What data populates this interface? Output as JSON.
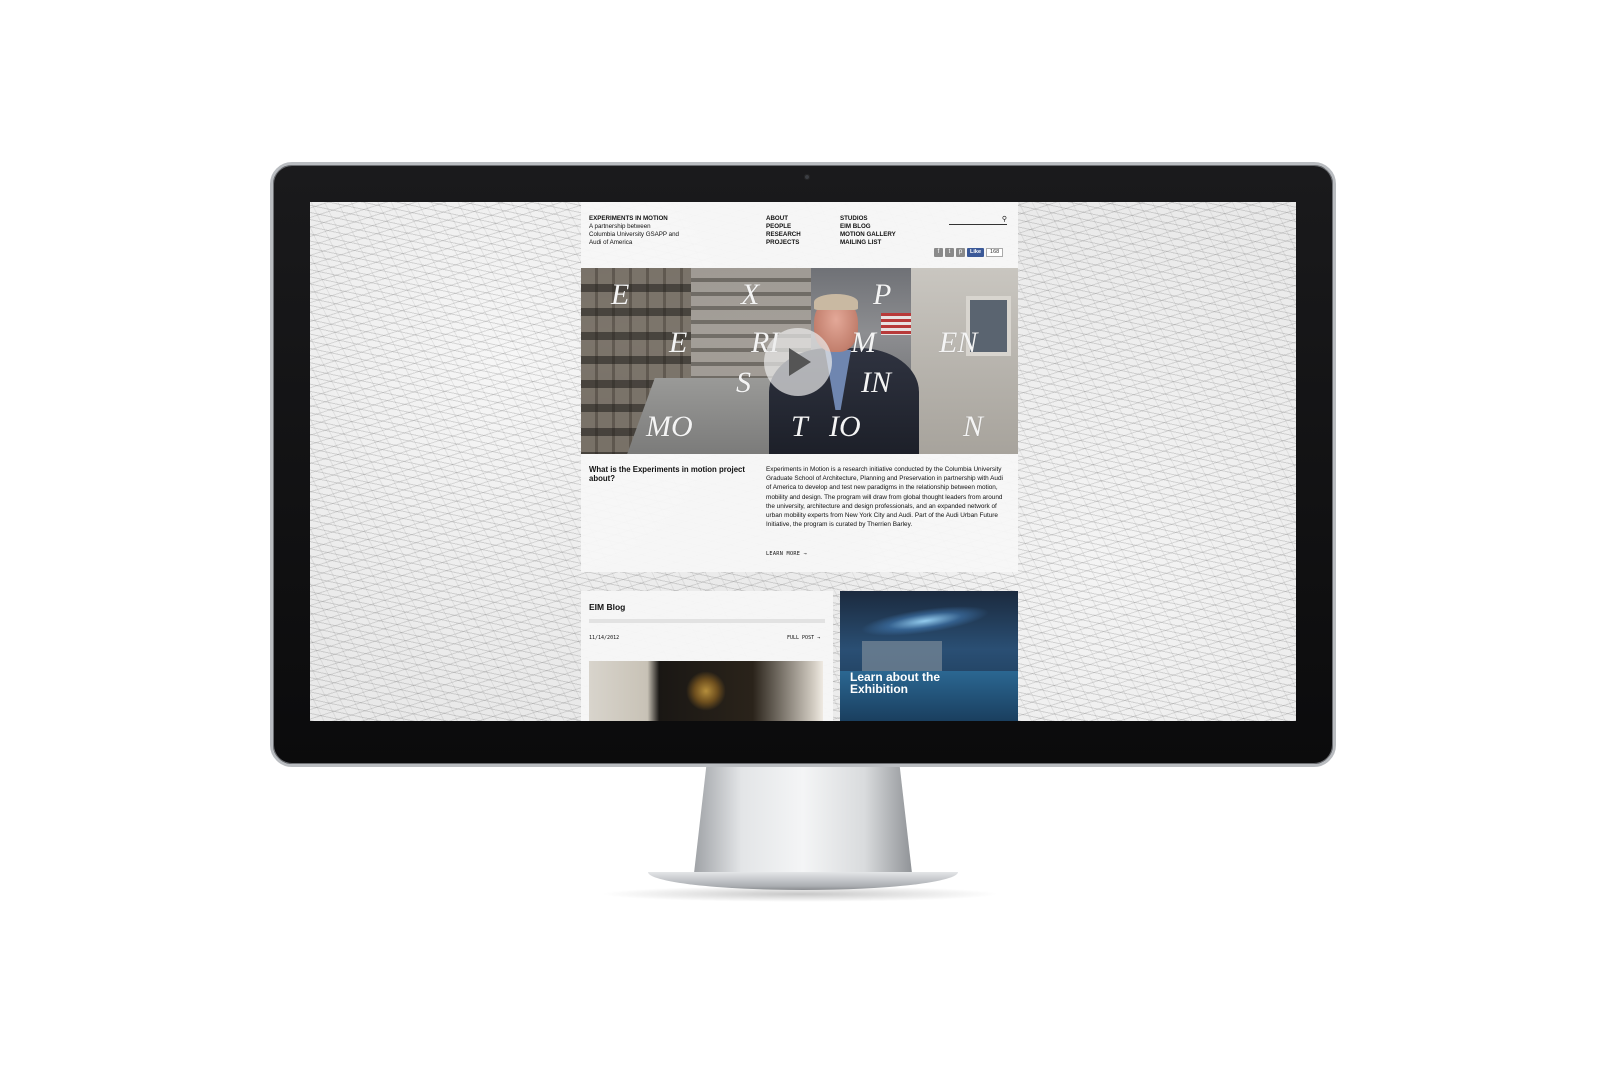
{
  "site": {
    "brand_title": "EXPERIMENTS IN MOTION",
    "brand_subtitle_1": "A partnership between",
    "brand_subtitle_2": "Columbia University GSAPP and",
    "brand_subtitle_3": "Audi of America"
  },
  "nav": {
    "col1": [
      "ABOUT",
      "PEOPLE",
      "RESEARCH",
      "PROJECTS"
    ],
    "col2": [
      "STUDIOS",
      "EIM BLOG",
      "MOTION GALLERY",
      "MAILING LIST"
    ]
  },
  "search": {
    "placeholder": ""
  },
  "social": {
    "icons": [
      "facebook-icon",
      "twitter-icon",
      "pinterest-icon"
    ],
    "like_label": "Like",
    "like_count": "168"
  },
  "hero": {
    "letters": [
      "E",
      "X",
      "P",
      "E",
      "RI",
      "M",
      "EN",
      "S",
      "IN",
      "MO",
      "T",
      "IO",
      "N"
    ]
  },
  "about": {
    "question": "What is the Experiments in motion project about?",
    "text": "Experiments in Motion is a research initiative conducted by the Columbia University Graduate School of Architecture, Planning and Preservation in partnership with Audi of America to develop and test new paradigms in the relationship between motion, mobility and design. The program will draw from global thought leaders from around the university, architecture and design professionals, and an expanded network of urban mobility experts from New York City and Audi. Part of the Audi Urban Future Initiative, the program is curated by Therrien Barley.",
    "learn_more": "LEARN MORE →"
  },
  "blog": {
    "title": "EIM Blog",
    "date": "11/14/2012",
    "full_post": "FULL POST →"
  },
  "exhibition": {
    "title": "Learn about the Exhibition"
  },
  "colors": {
    "monitor_bezel": "#0b0b0c",
    "facebook_blue": "#3b5998",
    "exhibition_blue": "#2a4f74"
  }
}
